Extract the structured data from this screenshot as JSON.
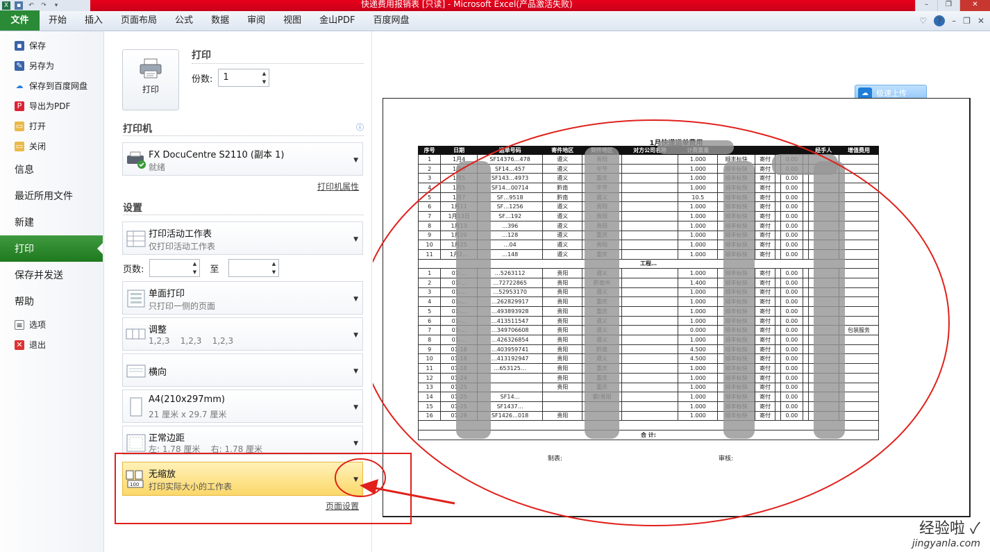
{
  "window": {
    "title": "快递费用报销表 [只读] - Microsoft Excel(产品激活失败)",
    "controls": [
      "–",
      "❐",
      "✕"
    ]
  },
  "ribbon": {
    "tabs": [
      "文件",
      "开始",
      "插入",
      "页面布局",
      "公式",
      "数据",
      "审阅",
      "视图",
      "金山PDF",
      "百度网盘"
    ]
  },
  "nav": {
    "small_top": [
      {
        "label": "保存",
        "icon": "save-icon"
      },
      {
        "label": "另存为",
        "icon": "save-as-icon"
      },
      {
        "label": "保存到百度网盘",
        "icon": "baidu-cloud-icon"
      },
      {
        "label": "导出为PDF",
        "icon": "pdf-icon"
      },
      {
        "label": "打开",
        "icon": "folder-open-icon"
      },
      {
        "label": "关闭",
        "icon": "folder-close-icon"
      }
    ],
    "big": [
      "信息",
      "最近所用文件",
      "新建",
      "打印",
      "保存并发送",
      "帮助"
    ],
    "active": "打印",
    "small_bottom": [
      {
        "label": "选项",
        "icon": "options-icon"
      },
      {
        "label": "退出",
        "icon": "exit-icon"
      }
    ]
  },
  "print": {
    "heading": "打印",
    "button_label": "打印",
    "copies_label": "份数:",
    "copies_value": "1",
    "printer_heading": "打印机",
    "printer_name": "FX DocuCentre S2110 (副本 1)",
    "printer_status": "就绪",
    "printer_props": "打印机属性",
    "settings_heading": "设置",
    "settings": [
      {
        "t1": "打印活动工作表",
        "t2": "仅打印活动工作表"
      },
      {
        "t1": "单面打印",
        "t2": "只打印一侧的页面"
      },
      {
        "t1": "调整",
        "t2": "1,2,3    1,2,3    1,2,3"
      },
      {
        "t1": "横向",
        "t2": ""
      },
      {
        "t1": "A4(210x297mm)",
        "t2": "21 厘米 x 29.7 厘米"
      },
      {
        "t1": "正常边距",
        "t2": "左: 1.78 厘米    右: 1.78 厘米"
      },
      {
        "t1": "无缩放",
        "t2": "打印实际大小的工作表"
      }
    ],
    "pages_label": "页数:",
    "to_label": "至",
    "page_setup": "页面设置"
  },
  "preview": {
    "upload_label": "极速上传",
    "sheet_title": "1月快递运单费用",
    "headers": [
      "序号",
      "日期",
      "运单号码",
      "寄件地区",
      "到件地区",
      "对方公司名称",
      "计费重量",
      "",
      "",
      "",
      "",
      "",
      "经手人",
      "增值费用"
    ],
    "section1_rows": [
      [
        "1",
        "1月4",
        "SF14376…478",
        "遵义",
        "贵阳"
      ],
      [
        "2",
        "1月5",
        "SF14…457",
        "遵义",
        "毕节"
      ],
      [
        "3",
        "1月5",
        "SF143…4973",
        "遵义",
        "重庆"
      ],
      [
        "4",
        "1月5",
        "SF14…00714",
        "黔南",
        "毕节"
      ],
      [
        "5",
        "1月7",
        "SF…9518",
        "黔南",
        "遵义"
      ],
      [
        "6",
        "1月11",
        "SF…1256",
        "遵义",
        "贵阳"
      ],
      [
        "7",
        "1月13日",
        "SF…192",
        "遵义",
        "贵阳"
      ],
      [
        "8",
        "1月13",
        "…396",
        "遵义",
        "贵阳"
      ],
      [
        "9",
        "1月20",
        "…128",
        "遵义",
        "重庆"
      ],
      [
        "10",
        "1月25",
        "…04",
        "遵义",
        "贵阳"
      ],
      [
        "11",
        "1月2…",
        "…148",
        "遵义",
        "重庆"
      ]
    ],
    "section2_label": "工程…",
    "section2_rows": [
      [
        "1",
        "01-…",
        "…5263112",
        "贵阳",
        "遵义"
      ],
      [
        "2",
        "01-…",
        "…72722865",
        "贵阳",
        "黔南州"
      ],
      [
        "3",
        "01-…",
        "…52953170",
        "贵阳",
        "遵义"
      ],
      [
        "4",
        "01-…",
        "…262829917",
        "贵阳",
        "重庆"
      ],
      [
        "5",
        "01-…",
        "…493893928",
        "贵阳",
        "重庆"
      ],
      [
        "6",
        "01-…",
        "…413511547",
        "贵阳",
        "遵义"
      ],
      [
        "7",
        "01-…",
        "…349706608",
        "贵阳",
        "遵义"
      ],
      [
        "8",
        "01-…",
        "…426326854",
        "贵阳",
        "遵义"
      ],
      [
        "9",
        "01-18",
        "…403959741",
        "贵阳",
        "黔南"
      ],
      [
        "10",
        "01-18",
        "…413192947",
        "贵阳",
        "遵义"
      ],
      [
        "11",
        "01-18",
        "…653125…",
        "贵阳",
        "重庆"
      ],
      [
        "12",
        "01-24",
        "",
        "贵阳",
        "重庆"
      ],
      [
        "13",
        "01-25",
        "",
        "贵阳",
        "重庆"
      ],
      [
        "14",
        "01-25",
        "SF14…",
        "",
        "都/贵阳"
      ],
      [
        "15",
        "01-25",
        "SF1437…",
        "",
        ""
      ],
      [
        "16",
        "01-28",
        "SF1426…018",
        "贵阳",
        ""
      ]
    ],
    "weights": [
      "1.000",
      "1.000",
      "1.000",
      "1.000",
      "10.5",
      "1.000",
      "1.000",
      "1.000",
      "1.000",
      "1.000",
      "1.000"
    ],
    "weights2": [
      "1.000",
      "1.400",
      "1.000",
      "1.000",
      "1.000",
      "1.000",
      "0.000",
      "1.000",
      "4.500",
      "4.500",
      "1.000",
      "1.000",
      "1.000",
      "1.000",
      "1.000",
      "1.000"
    ],
    "carrier": "顺丰标快",
    "pay": "寄付",
    "zero": "0.00",
    "extra_service": "包装服务",
    "total_label": "合 计:",
    "made_by": "制表:",
    "reviewed_by": "审核:"
  },
  "watermark": {
    "line1": "经验啦 ✓",
    "line2": "jingyanla.com"
  },
  "annotation_color": "#e0201b"
}
